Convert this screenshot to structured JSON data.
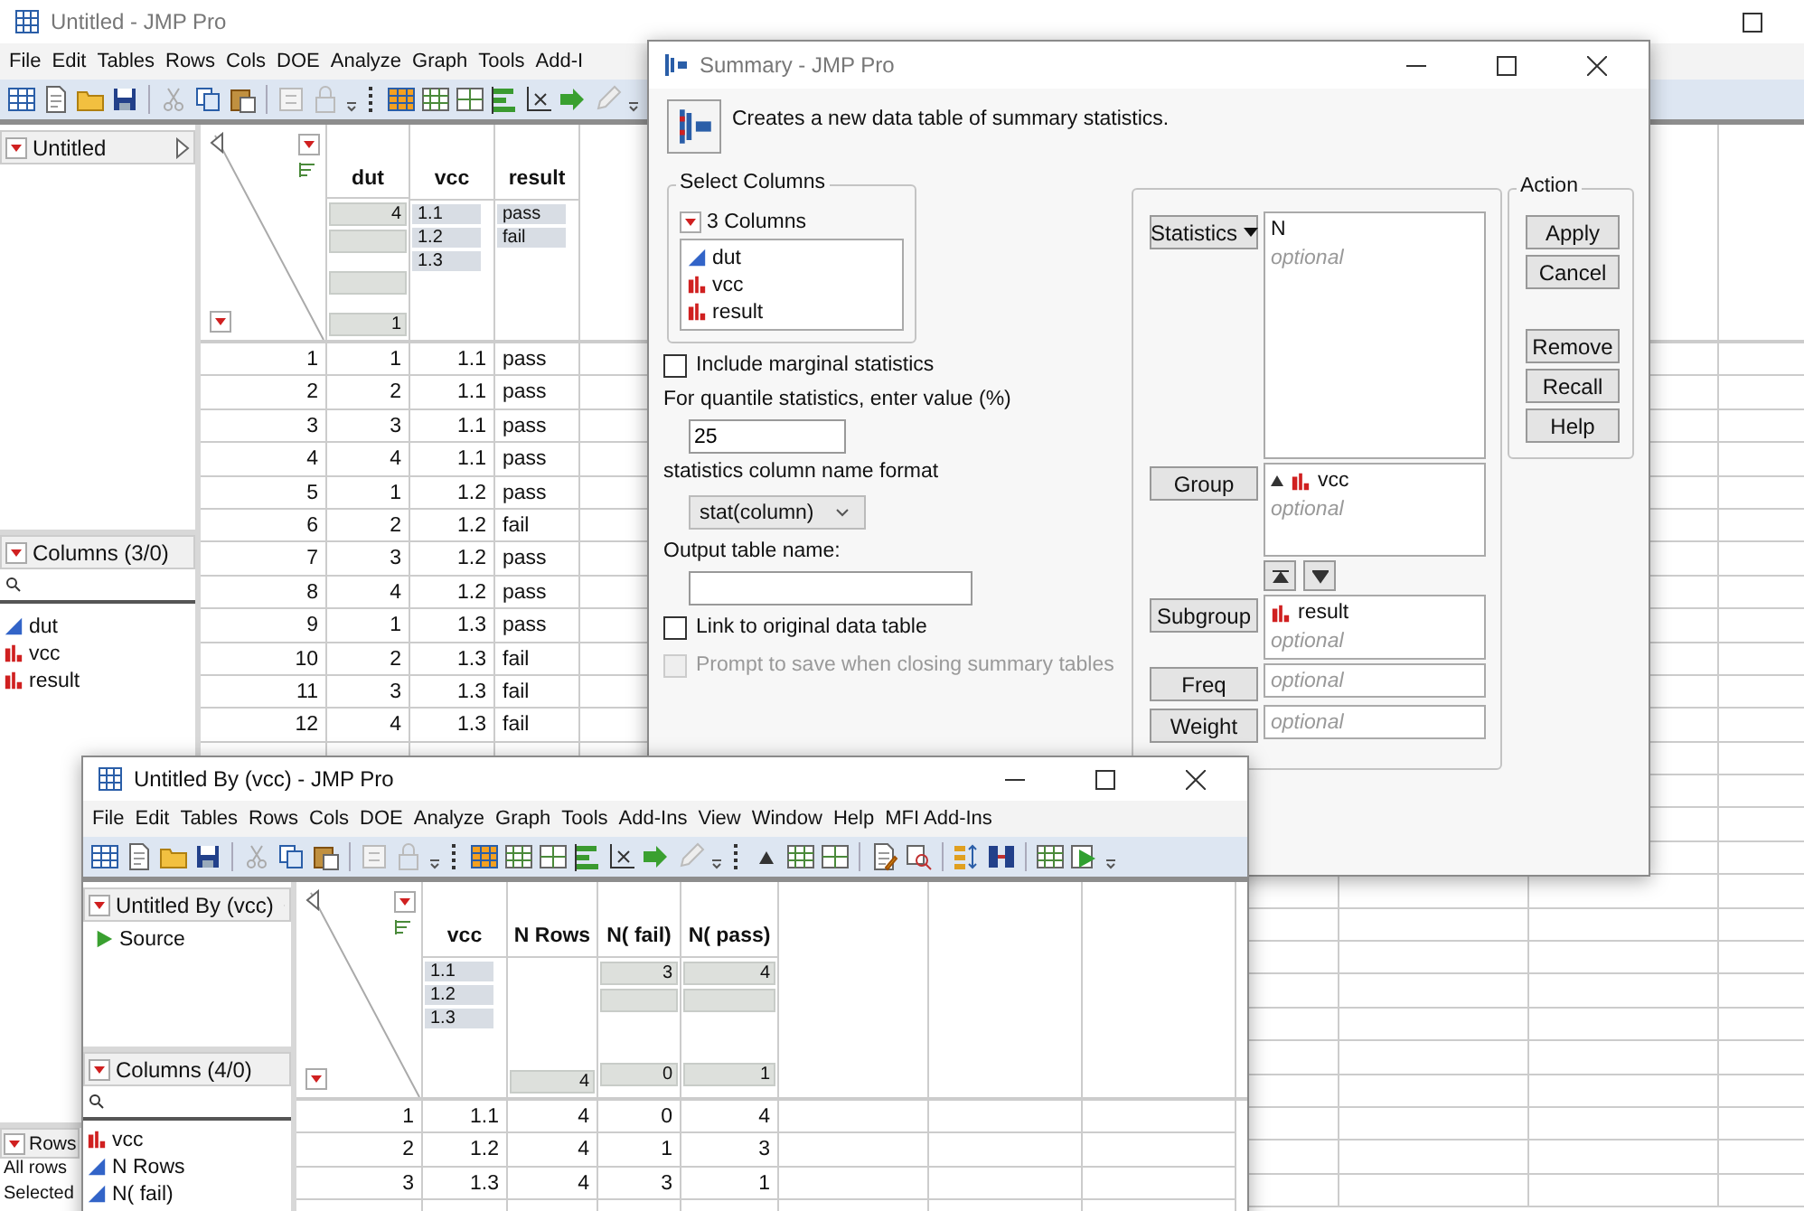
{
  "main_window": {
    "title": "Untitled - JMP Pro",
    "menu": [
      "File",
      "Edit",
      "Tables",
      "Rows",
      "Cols",
      "DOE",
      "Analyze",
      "Graph",
      "Tools",
      "Add-I"
    ],
    "table_panel": {
      "title": "Untitled"
    },
    "columns_panel": {
      "title": "Columns (3/0)",
      "columns": [
        {
          "name": "dut",
          "kind": "continuous"
        },
        {
          "name": "vcc",
          "kind": "nominal"
        },
        {
          "name": "result",
          "kind": "nominal"
        }
      ]
    },
    "rows_panel": {
      "title": "Rows",
      "lines": [
        "All rows",
        "Selected"
      ]
    },
    "table": {
      "columns": [
        {
          "name": "dut",
          "kind": "continuous",
          "max": "4",
          "min": "1"
        },
        {
          "name": "vcc",
          "kind": "nominal",
          "levels": [
            "1.1",
            "1.2",
            "1.3"
          ]
        },
        {
          "name": "result",
          "kind": "nominal",
          "levels": [
            "pass",
            "fail"
          ]
        }
      ],
      "rows": [
        {
          "number": "1",
          "cells": [
            "1",
            "1.1",
            "pass"
          ]
        },
        {
          "number": "2",
          "cells": [
            "2",
            "1.1",
            "pass"
          ]
        },
        {
          "number": "3",
          "cells": [
            "3",
            "1.1",
            "pass"
          ]
        },
        {
          "number": "4",
          "cells": [
            "4",
            "1.1",
            "pass"
          ]
        },
        {
          "number": "5",
          "cells": [
            "1",
            "1.2",
            "pass"
          ]
        },
        {
          "number": "6",
          "cells": [
            "2",
            "1.2",
            "fail"
          ]
        },
        {
          "number": "7",
          "cells": [
            "3",
            "1.2",
            "pass"
          ]
        },
        {
          "number": "8",
          "cells": [
            "4",
            "1.2",
            "pass"
          ]
        },
        {
          "number": "9",
          "cells": [
            "1",
            "1.3",
            "pass"
          ]
        },
        {
          "number": "10",
          "cells": [
            "2",
            "1.3",
            "fail"
          ]
        },
        {
          "number": "11",
          "cells": [
            "3",
            "1.3",
            "fail"
          ]
        },
        {
          "number": "12",
          "cells": [
            "4",
            "1.3",
            "fail"
          ]
        }
      ]
    }
  },
  "summary_dialog": {
    "title": "Summary - JMP Pro",
    "description": "Creates a new data table of summary statistics.",
    "select_columns": {
      "label": "Select Columns",
      "count": "3 Columns",
      "columns": [
        {
          "name": "dut",
          "kind": "continuous"
        },
        {
          "name": "vcc",
          "kind": "nominal"
        },
        {
          "name": "result",
          "kind": "nominal"
        }
      ]
    },
    "options": [
      {
        "kind": "checkbox",
        "label": "Include marginal statistics",
        "checked": false,
        "disabled": false
      },
      {
        "kind": "field",
        "label": "For quantile statistics, enter value (%)",
        "value": "25"
      },
      {
        "kind": "dropdown",
        "label": "statistics column name format",
        "value": "stat(column)"
      },
      {
        "kind": "field",
        "label": "Output table name:"
      },
      {
        "kind": "checkbox",
        "label": "Link to original data table",
        "checked": false,
        "disabled": false
      },
      {
        "kind": "checkbox",
        "label": "Prompt to save when closing summary tables",
        "checked": false,
        "disabled": true
      }
    ],
    "roles": [
      {
        "button": "Statistics",
        "dropdown": true,
        "items": [
          {
            "name": "N",
            "kind": "statistic",
            "sorted": false
          }
        ],
        "placeholder": "optional"
      },
      {
        "button": "Group",
        "dropdown": false,
        "items": [
          {
            "name": "vcc",
            "kind": "nominal",
            "sorted": true
          }
        ],
        "placeholder": "optional"
      },
      {
        "button": "Subgroup",
        "dropdown": false,
        "items": [
          {
            "name": "result",
            "kind": "nominal",
            "sorted": false
          }
        ],
        "placeholder": "optional"
      },
      {
        "button": "Freq",
        "dropdown": false,
        "placeholder": "optional"
      },
      {
        "button": "Weight",
        "dropdown": false,
        "placeholder": "optional"
      }
    ],
    "action": {
      "label": "Action",
      "buttons": [
        "Apply",
        "Cancel"
      ],
      "more_buttons": [
        "Remove",
        "Recall",
        "Help"
      ]
    }
  },
  "by_window": {
    "title": "Untitled By (vcc) - JMP Pro",
    "menu": [
      "File",
      "Edit",
      "Tables",
      "Rows",
      "Cols",
      "DOE",
      "Analyze",
      "Graph",
      "Tools",
      "Add-Ins",
      "View",
      "Window",
      "Help",
      "MFI Add-Ins"
    ],
    "table_panel": {
      "title": "Untitled By (vcc)",
      "scripts": [
        "Source"
      ]
    },
    "columns_panel": {
      "title": "Columns (4/0)",
      "columns": [
        {
          "name": "vcc",
          "kind": "nominal"
        },
        {
          "name": "N Rows",
          "kind": "continuous"
        },
        {
          "name": "N( fail)",
          "kind": "continuous"
        }
      ]
    },
    "table": {
      "columns": [
        {
          "name": "vcc",
          "kind": "nominal",
          "levels": [
            "1.1",
            "1.2",
            "1.3"
          ]
        },
        {
          "name": "N Rows",
          "kind": "continuous",
          "min": "4"
        },
        {
          "name": "N( fail)",
          "kind": "continuous",
          "max": "3",
          "min": "0"
        },
        {
          "name": "N( pass)",
          "kind": "continuous",
          "max": "4",
          "min": "1"
        }
      ],
      "rows": [
        {
          "number": "1",
          "cells": [
            "1.1",
            "4",
            "0",
            "4"
          ]
        },
        {
          "number": "2",
          "cells": [
            "1.2",
            "4",
            "1",
            "3"
          ]
        },
        {
          "number": "3",
          "cells": [
            "1.3",
            "4",
            "3",
            "1"
          ]
        }
      ]
    }
  }
}
